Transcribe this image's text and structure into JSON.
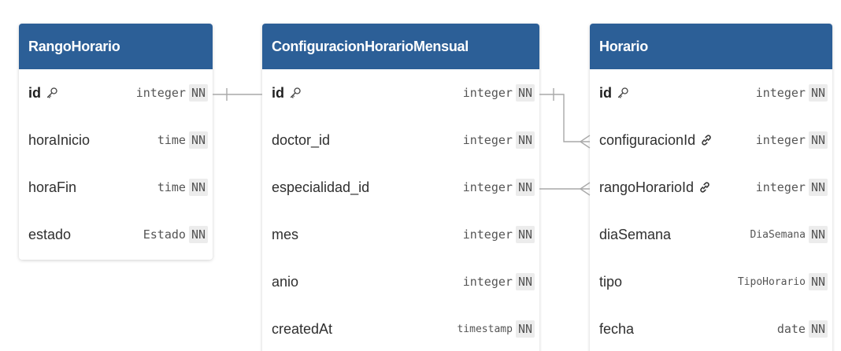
{
  "tables": {
    "rango_horario": {
      "title": "RangoHorario",
      "columns": [
        {
          "name": "id",
          "type": "integer",
          "nn": "NN",
          "pk": true
        },
        {
          "name": "horaInicio",
          "type": "time",
          "nn": "NN"
        },
        {
          "name": "horaFin",
          "type": "time",
          "nn": "NN"
        },
        {
          "name": "estado",
          "type": "Estado",
          "nn": "NN"
        }
      ]
    },
    "configuracion": {
      "title": "ConfiguracionHorarioMensual",
      "columns": [
        {
          "name": "id",
          "type": "integer",
          "nn": "NN",
          "pk": true
        },
        {
          "name": "doctor_id",
          "type": "integer",
          "nn": "NN"
        },
        {
          "name": "especialidad_id",
          "type": "integer",
          "nn": "NN"
        },
        {
          "name": "mes",
          "type": "integer",
          "nn": "NN"
        },
        {
          "name": "anio",
          "type": "integer",
          "nn": "NN"
        },
        {
          "name": "createdAt",
          "type": "timestamp",
          "nn": "NN"
        }
      ]
    },
    "horario": {
      "title": "Horario",
      "columns": [
        {
          "name": "id",
          "type": "integer",
          "nn": "NN",
          "pk": true
        },
        {
          "name": "configuracionId",
          "type": "integer",
          "nn": "NN",
          "fk": true
        },
        {
          "name": "rangoHorarioId",
          "type": "integer",
          "nn": "NN",
          "fk": true
        },
        {
          "name": "diaSemana",
          "type": "DiaSemana",
          "nn": "NN"
        },
        {
          "name": "tipo",
          "type": "TipoHorario",
          "nn": "NN"
        },
        {
          "name": "fecha",
          "type": "date",
          "nn": "NN"
        }
      ]
    }
  },
  "colors": {
    "header": "#2c5f97",
    "connector": "#a9a9a9"
  },
  "icons": {
    "pk": "key-icon",
    "fk": "link-icon"
  }
}
